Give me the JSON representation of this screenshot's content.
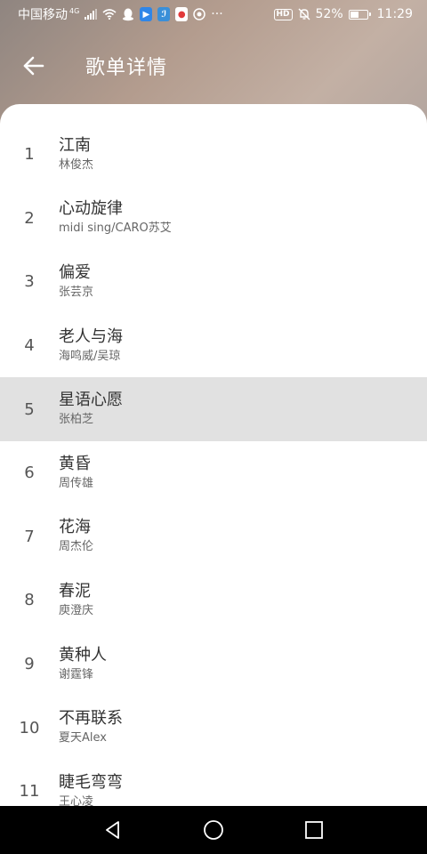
{
  "status_bar": {
    "carrier": "中国移动",
    "network": "4G",
    "more_indicator": "···",
    "hd_label": "HD",
    "battery_percent": "52%",
    "battery_level": 0.52,
    "time": "11:29",
    "icons": [
      "signal-icon",
      "wifi-icon",
      "qq-icon",
      "message-app-icon",
      "feather-app-icon",
      "map-pin-app-icon",
      "settings-app-icon",
      "hd-icon",
      "mute-icon",
      "battery-icon"
    ]
  },
  "toolbar": {
    "title": "歌单详情",
    "back_icon": "arrow-left-icon"
  },
  "songs": [
    {
      "index": "1",
      "title": "江南",
      "artist": "林俊杰"
    },
    {
      "index": "2",
      "title": "心动旋律",
      "artist": "midi sing/CARO苏艾"
    },
    {
      "index": "3",
      "title": "偏爱",
      "artist": "张芸京"
    },
    {
      "index": "4",
      "title": "老人与海",
      "artist": "海鸣威/吴琼"
    },
    {
      "index": "5",
      "title": "星语心愿",
      "artist": "张柏芝",
      "selected": true
    },
    {
      "index": "6",
      "title": "黄昏",
      "artist": "周传雄"
    },
    {
      "index": "7",
      "title": "花海",
      "artist": "周杰伦"
    },
    {
      "index": "8",
      "title": "春泥",
      "artist": "庾澄庆"
    },
    {
      "index": "9",
      "title": "黄种人",
      "artist": "谢霆锋"
    },
    {
      "index": "10",
      "title": "不再联系",
      "artist": "夏天Alex"
    },
    {
      "index": "11",
      "title": "睫毛弯弯",
      "artist": "王心凌"
    }
  ],
  "nav_bar": {
    "icons": [
      "back-triangle-icon",
      "home-circle-icon",
      "recents-square-icon"
    ]
  },
  "colors": {
    "selected_row": "#e1e1e1",
    "title_text": "#333333",
    "artist_text": "#666666",
    "header_tint": "#b39c8e",
    "nav_bar": "#000000"
  }
}
